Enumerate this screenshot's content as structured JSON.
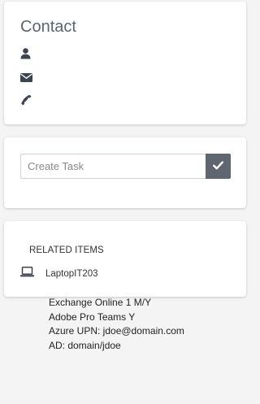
{
  "contact": {
    "title": "Contact",
    "name": "",
    "email": "",
    "phone": "",
    "icons": [
      "user-icon",
      "envelope-icon",
      "phone-icon"
    ]
  },
  "task": {
    "placeholder": "Create Task",
    "value": "",
    "submit_icon": "check-icon"
  },
  "related": {
    "header": "RELATED ITEMS",
    "items": [
      {
        "icon": "laptop-icon",
        "name": "LaptopIT203",
        "details": [
          "Exchange Online 1 M/Y",
          "Adobe Pro Teams Y",
          "Azure UPN: jdoe@domain.com",
          "AD: domain/jdoe"
        ]
      }
    ]
  },
  "colors": {
    "background": "#f4f4f4",
    "card": "#ffffff",
    "title_text": "#5c6470",
    "icon_dark": "#3c4450",
    "submit_button": "#5f6670"
  }
}
